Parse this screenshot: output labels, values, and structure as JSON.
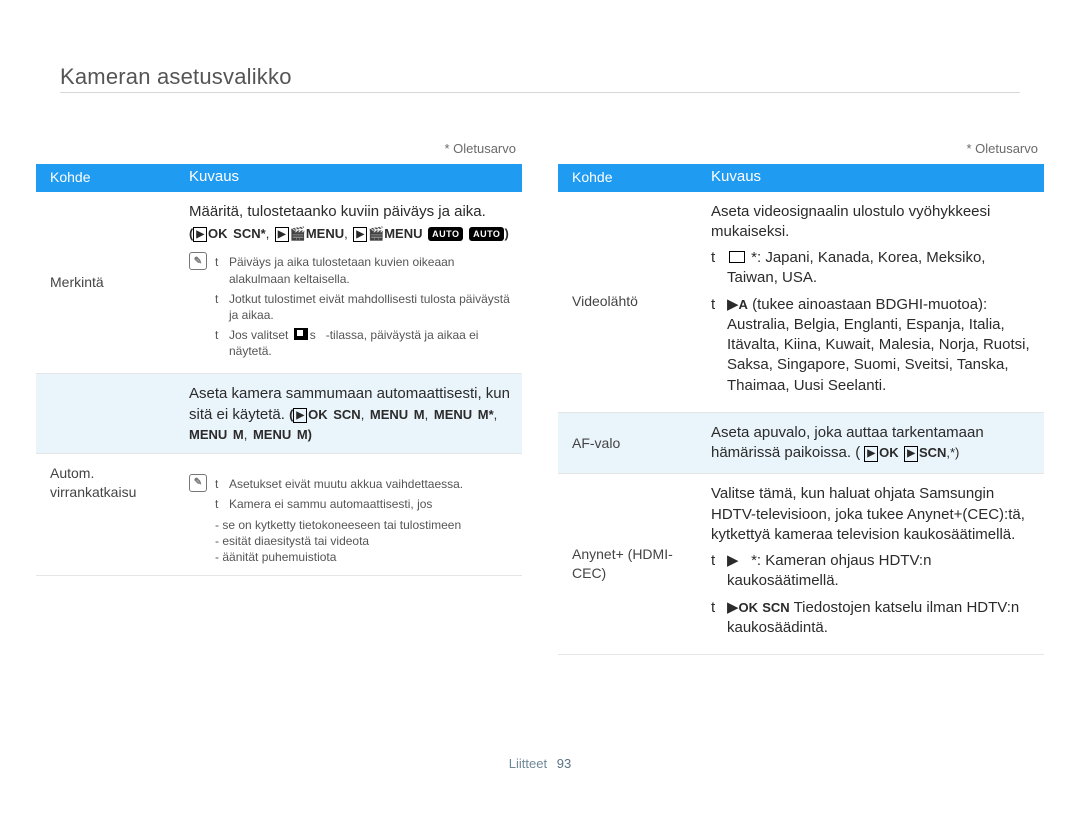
{
  "page_title": "Kameran asetusvalikko",
  "default_note": "* Oletusarvo",
  "footer": {
    "label": "Liitteet",
    "page_number": "93"
  },
  "headers": {
    "item": "Kohde",
    "desc": "Kuvaus"
  },
  "left": {
    "row1": {
      "item": "Merkintä",
      "mainline": "Määritä, tulostetaanko kuviin päiväys ja aika.",
      "notes": {
        "n1": "Päiväys ja aika tulostetaan kuvien oikeaan alakulmaan keltaisella.",
        "n2": "Jotkut tulostimet eivät mahdollisesti tulosta päiväystä ja aikaa.",
        "n3a": "Jos valitset",
        "n3b": "-tilassa, päiväystä ja aikaa ei näytetä."
      }
    },
    "row2": {
      "item": "Autom. virrankatkaisu",
      "mainline": "Aseta kamera sammumaan automaattisesti, kun sitä ei käytetä.",
      "notes": {
        "n1": "Asetukset eivät muutu akkua vaihdettaessa.",
        "n2": "Kamera ei sammu automaattisesti, jos",
        "d1": "se on kytketty tietokoneeseen tai tulostimeen",
        "d2": "esität diaesitystä tai videota",
        "d3": "äänität puhemuistiota"
      }
    }
  },
  "right": {
    "row1": {
      "item": "Videolähtö",
      "mainline": "Aseta videosignaalin ulostulo vyöhykkeesi mukaiseksi.",
      "b1": "*: Japani, Kanada, Korea, Meksiko, Taiwan, USA.",
      "b2": "(tukee ainoastaan BDGHI-muotoa): Australia, Belgia, Englanti, Espanja, Italia, Itävalta, Kiina, Kuwait, Malesia, Norja, Ruotsi, Saksa, Singapore, Suomi, Sveitsi, Tanska, Thaimaa, Uusi Seelanti."
    },
    "row2": {
      "item": "AF-valo",
      "mainline": "Aseta apuvalo, joka auttaa tarkentamaan hämärissä paikoissa. ("
    },
    "row3": {
      "item": "Anynet+ (HDMI-CEC)",
      "mainline": "Valitse tämä, kun haluat ohjata Samsungin HDTV-televisioon, joka tukee Anynet+(CEC):tä, kytkettyä kameraa television kaukosäätimellä.",
      "b1": "*: Kameran ohjaus HDTV:n kaukosäätimellä.",
      "b2": "Tiedostojen katselu ilman HDTV:n kaukosäädintä."
    }
  }
}
